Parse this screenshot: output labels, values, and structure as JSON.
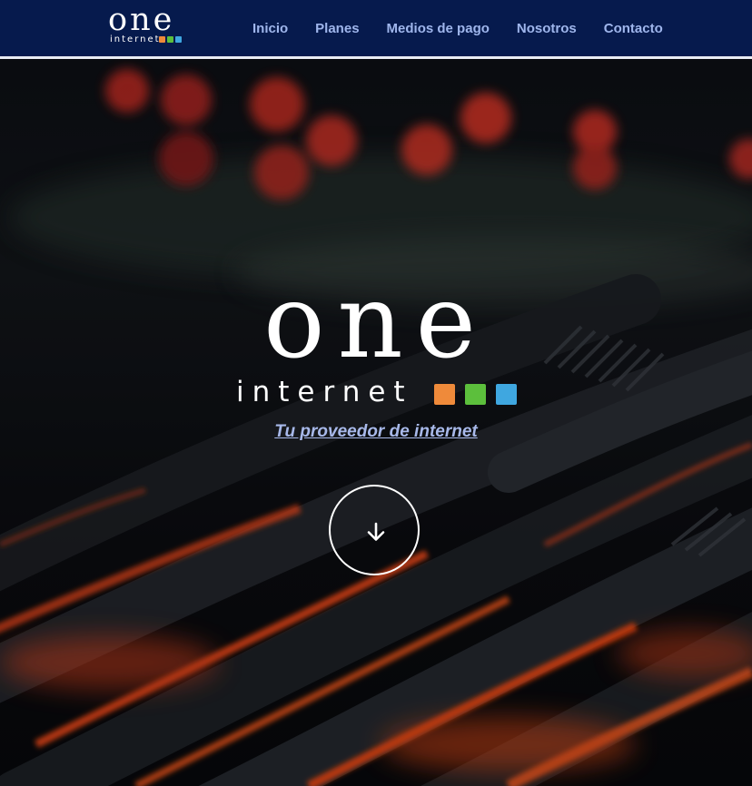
{
  "brand": {
    "name": "one",
    "sub": "internet",
    "square_colors": [
      "#ef8a3a",
      "#5cbf3c",
      "#3fa7e0"
    ]
  },
  "nav": {
    "items": [
      {
        "label": "Inicio"
      },
      {
        "label": "Planes"
      },
      {
        "label": "Medios de pago"
      },
      {
        "label": "Nosotros"
      },
      {
        "label": "Contacto"
      }
    ]
  },
  "hero": {
    "tagline": "Tu proveedor de internet",
    "scroll_icon": "arrow-down-icon"
  },
  "colors": {
    "navbar_bg": "#061a4d",
    "nav_link": "#9fb6ec",
    "tagline": "#a8b9ea"
  }
}
